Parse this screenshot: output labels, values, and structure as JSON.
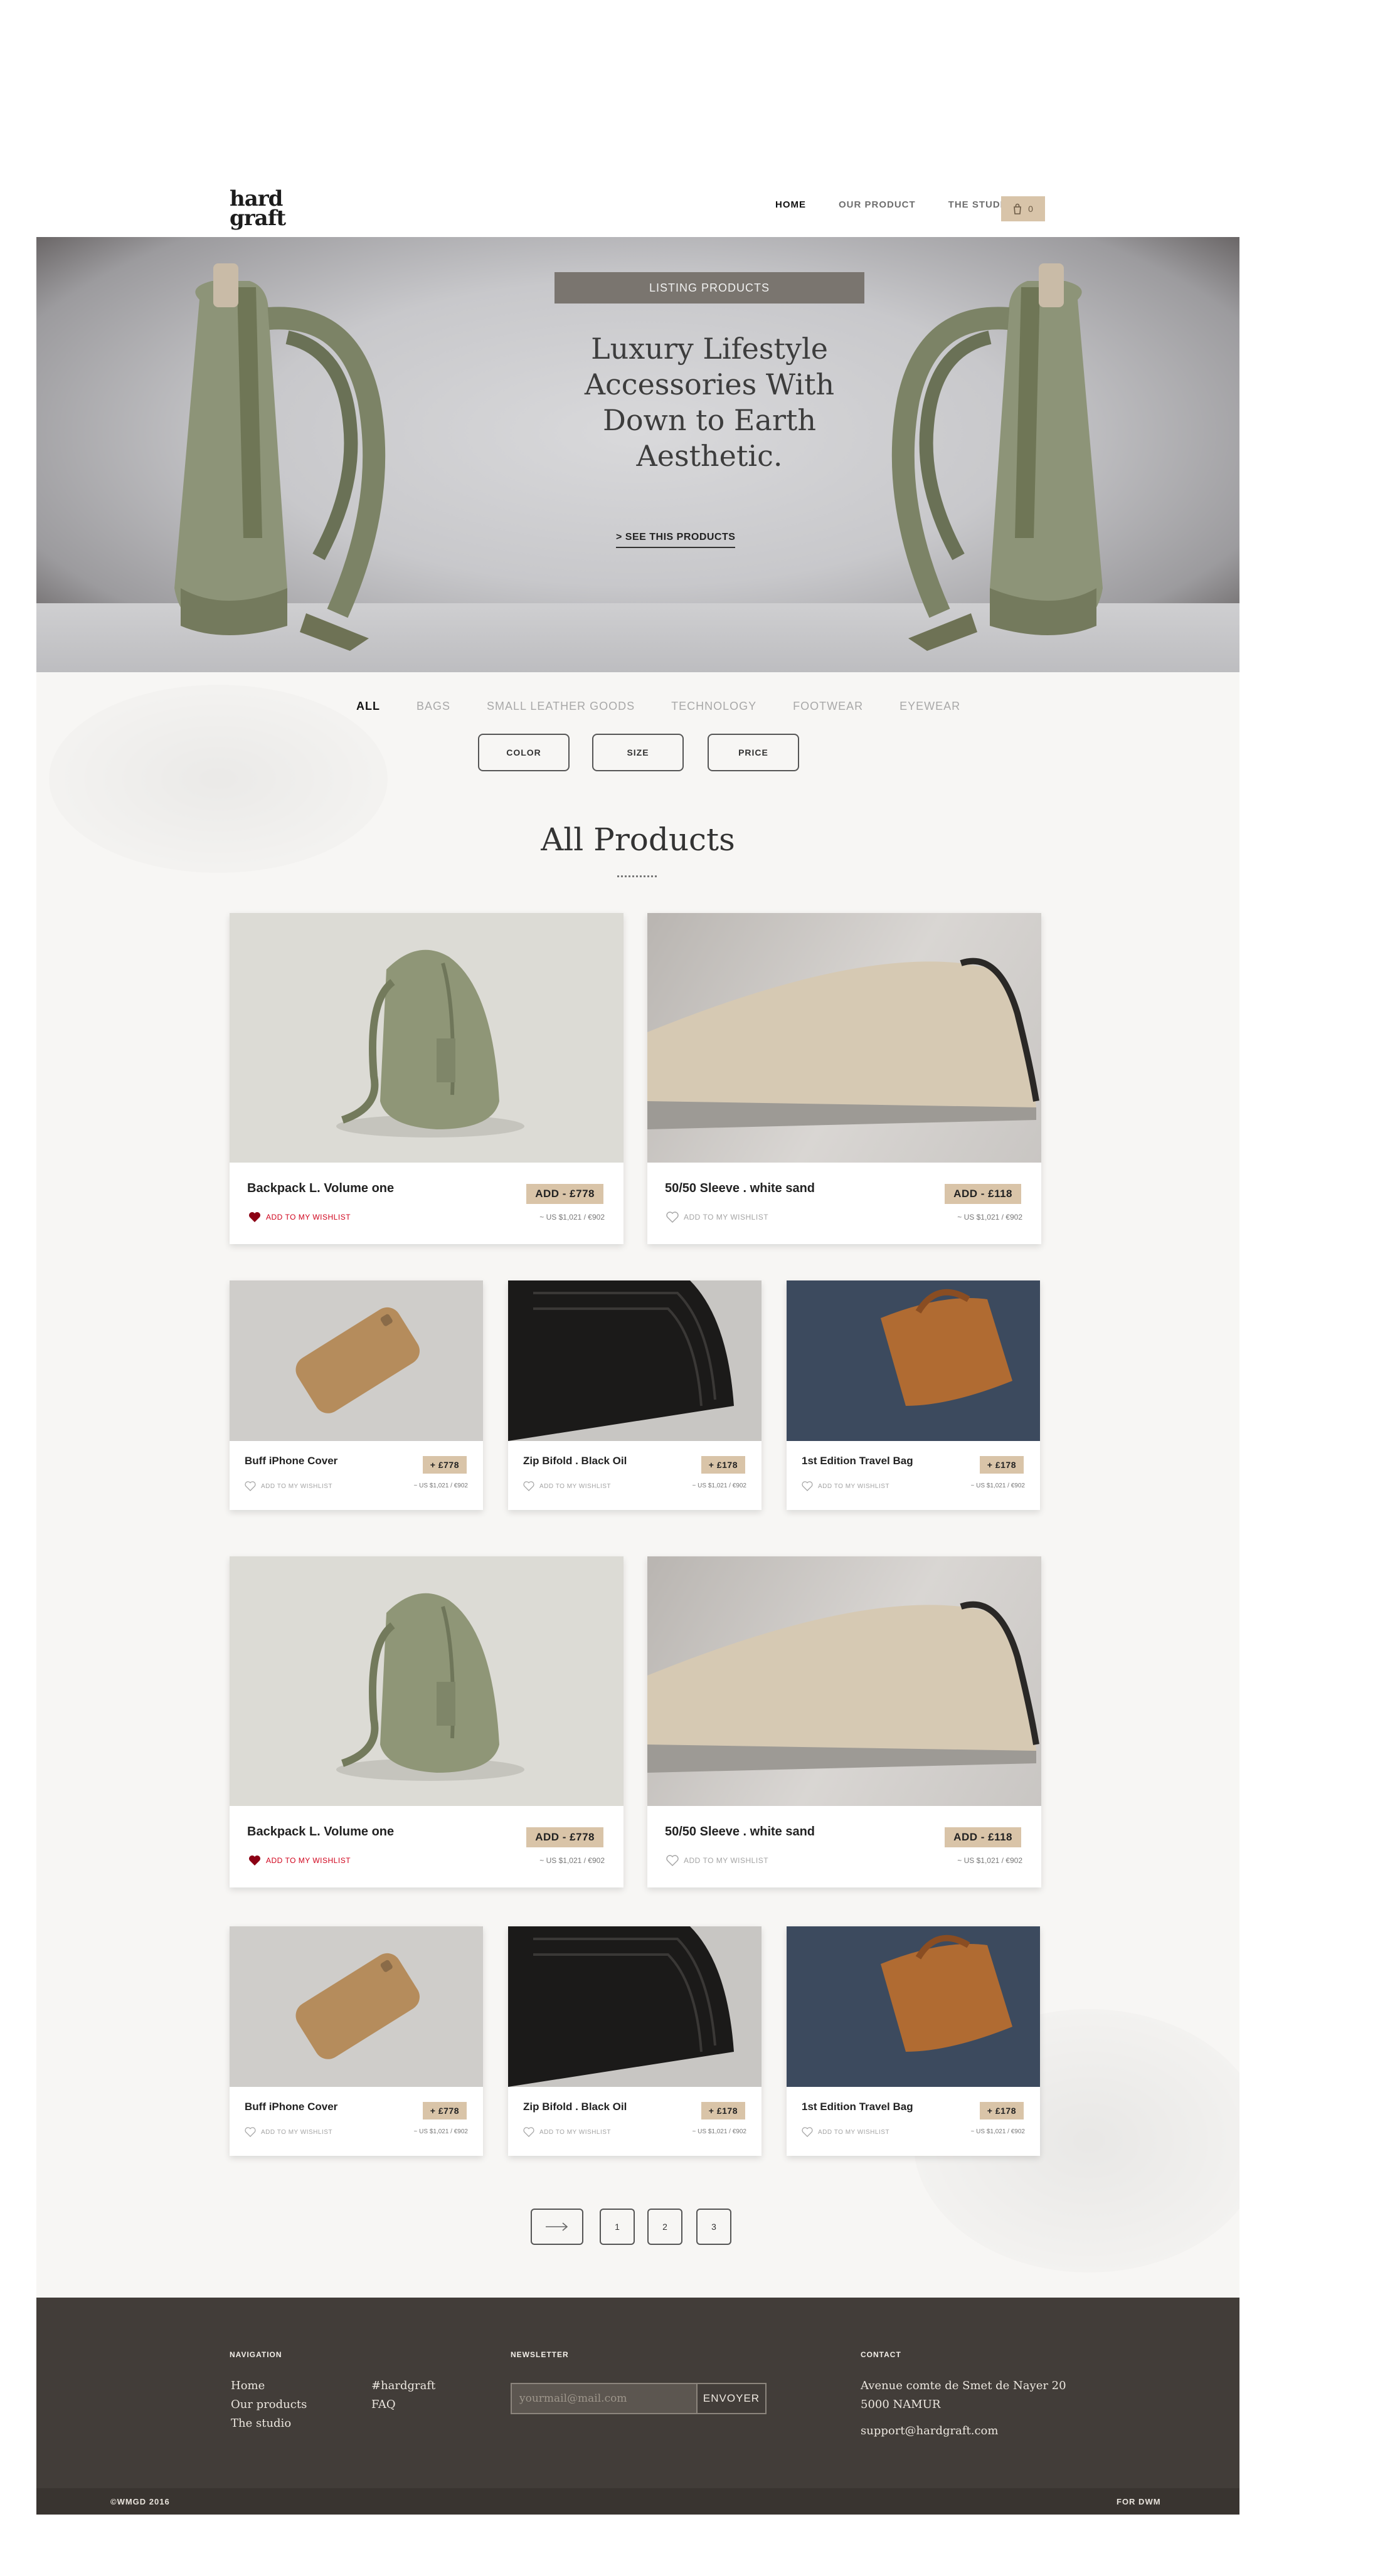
{
  "brand": {
    "line1": "hard",
    "line2": "graft"
  },
  "nav": {
    "items": [
      "HOME",
      "OUR PRODUCT",
      "THE STUDIO"
    ],
    "cart_count": "0"
  },
  "hero": {
    "tag": "LISTING PRODUCTS",
    "title_lines": [
      "Luxury Lifestyle",
      "Accessories With",
      "Down to Earth",
      "Aesthetic."
    ],
    "cta": "> SEE THIS PRODUCTS"
  },
  "categories": [
    "ALL",
    "BAGS",
    "SMALL LEATHER GOODS",
    "TECHNOLOGY",
    "FOOTWEAR",
    "EYEWEAR"
  ],
  "filters": [
    "COLOR",
    "SIZE",
    "PRICE"
  ],
  "section_title": "All Products",
  "products": [
    {
      "name": "Backpack L. Volume one",
      "price": "ADD - £778",
      "wishlist": "ADD TO MY WISHLIST",
      "converted": "~ US $1,021 / €902",
      "wished": true
    },
    {
      "name": "50/50 Sleeve . white sand",
      "price": "ADD - £118",
      "wishlist": "ADD TO MY WISHLIST",
      "converted": "~ US $1,021 / €902",
      "wished": false
    },
    {
      "name": "Buff iPhone Cover",
      "price": "+ £778",
      "wishlist": "ADD TO MY WISHLIST",
      "converted": "~ US $1,021 / €902",
      "wished": false
    },
    {
      "name": "Zip Bifold . Black Oil",
      "price": "+ £178",
      "wishlist": "ADD TO MY WISHLIST",
      "converted": "~ US $1,021 / €902",
      "wished": false
    },
    {
      "name": "1st Edition Travel Bag",
      "price": "+ £178",
      "wishlist": "ADD TO MY WISHLIST",
      "converted": "~ US $1,021 / €902",
      "wished": false
    },
    {
      "name": "Backpack L. Volume one",
      "price": "ADD - £778",
      "wishlist": "ADD TO MY WISHLIST",
      "converted": "~ US $1,021 / €902",
      "wished": true
    },
    {
      "name": "50/50 Sleeve . white sand",
      "price": "ADD - £118",
      "wishlist": "ADD TO MY WISHLIST",
      "converted": "~ US $1,021 / €902",
      "wished": false
    },
    {
      "name": "Buff iPhone Cover",
      "price": "+ £778",
      "wishlist": "ADD TO MY WISHLIST",
      "converted": "~ US $1,021 / €902",
      "wished": false
    },
    {
      "name": "Zip Bifold . Black Oil",
      "price": "+ £178",
      "wishlist": "ADD TO MY WISHLIST",
      "converted": "~ US $1,021 / €902",
      "wished": false
    },
    {
      "name": "1st Edition Travel Bag",
      "price": "+ £178",
      "wishlist": "ADD TO MY WISHLIST",
      "converted": "~ US $1,021 / €902",
      "wished": false
    }
  ],
  "pagination": {
    "pages": [
      "1",
      "2",
      "3"
    ]
  },
  "footer": {
    "navigation_heading": "NAVIGATION",
    "nav_links": [
      "Home",
      "Our products",
      "The studio"
    ],
    "extra_links": [
      "#hardgraft",
      "FAQ"
    ],
    "newsletter_heading": "NEWSLETTER",
    "newsletter_placeholder": "yourmail@mail.com",
    "newsletter_button": "ENVOYER",
    "contact_heading": "CONTACT",
    "address_line1": "Avenue comte de Smet de Nayer 20",
    "address_line2": "5000 NAMUR",
    "email": "support@hardgraft.com",
    "copyright": "©WMGD 2016",
    "credit": "FOR DWM"
  },
  "colors": {
    "accent": "#d9c4a8",
    "footer": "#423d39",
    "wishlist_active": "#d0021b"
  },
  "icons": [
    "cart-icon",
    "heart-icon",
    "arrow-right-icon"
  ]
}
